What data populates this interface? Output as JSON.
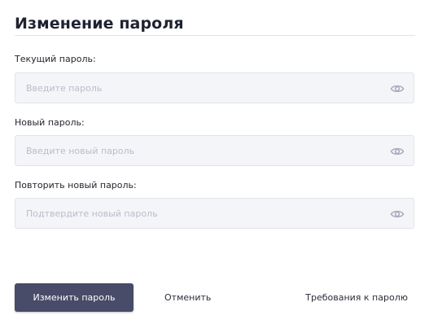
{
  "form": {
    "title": "Изменение пароля",
    "fields": [
      {
        "label": "Текущий пароль:",
        "value": "",
        "placeholder": "Введите пароль",
        "toggle_icon": "eye-icon"
      },
      {
        "label": "Новый пароль:",
        "value": "",
        "placeholder": "Введите новый пароль",
        "toggle_icon": "eye-icon"
      },
      {
        "label": "Повторить новый пароль:",
        "value": "",
        "placeholder": "Подтвердите новый пароль",
        "toggle_icon": "eye-icon"
      }
    ]
  },
  "actions": {
    "submit_label": "Изменить пароль",
    "cancel_label": "Отменить",
    "requirements_label": "Требования к паролю"
  },
  "colors": {
    "primary_button": "#484c69",
    "field_background": "#f4f5f8",
    "placeholder": "#b9bccb",
    "icon": "#a9adbd"
  }
}
